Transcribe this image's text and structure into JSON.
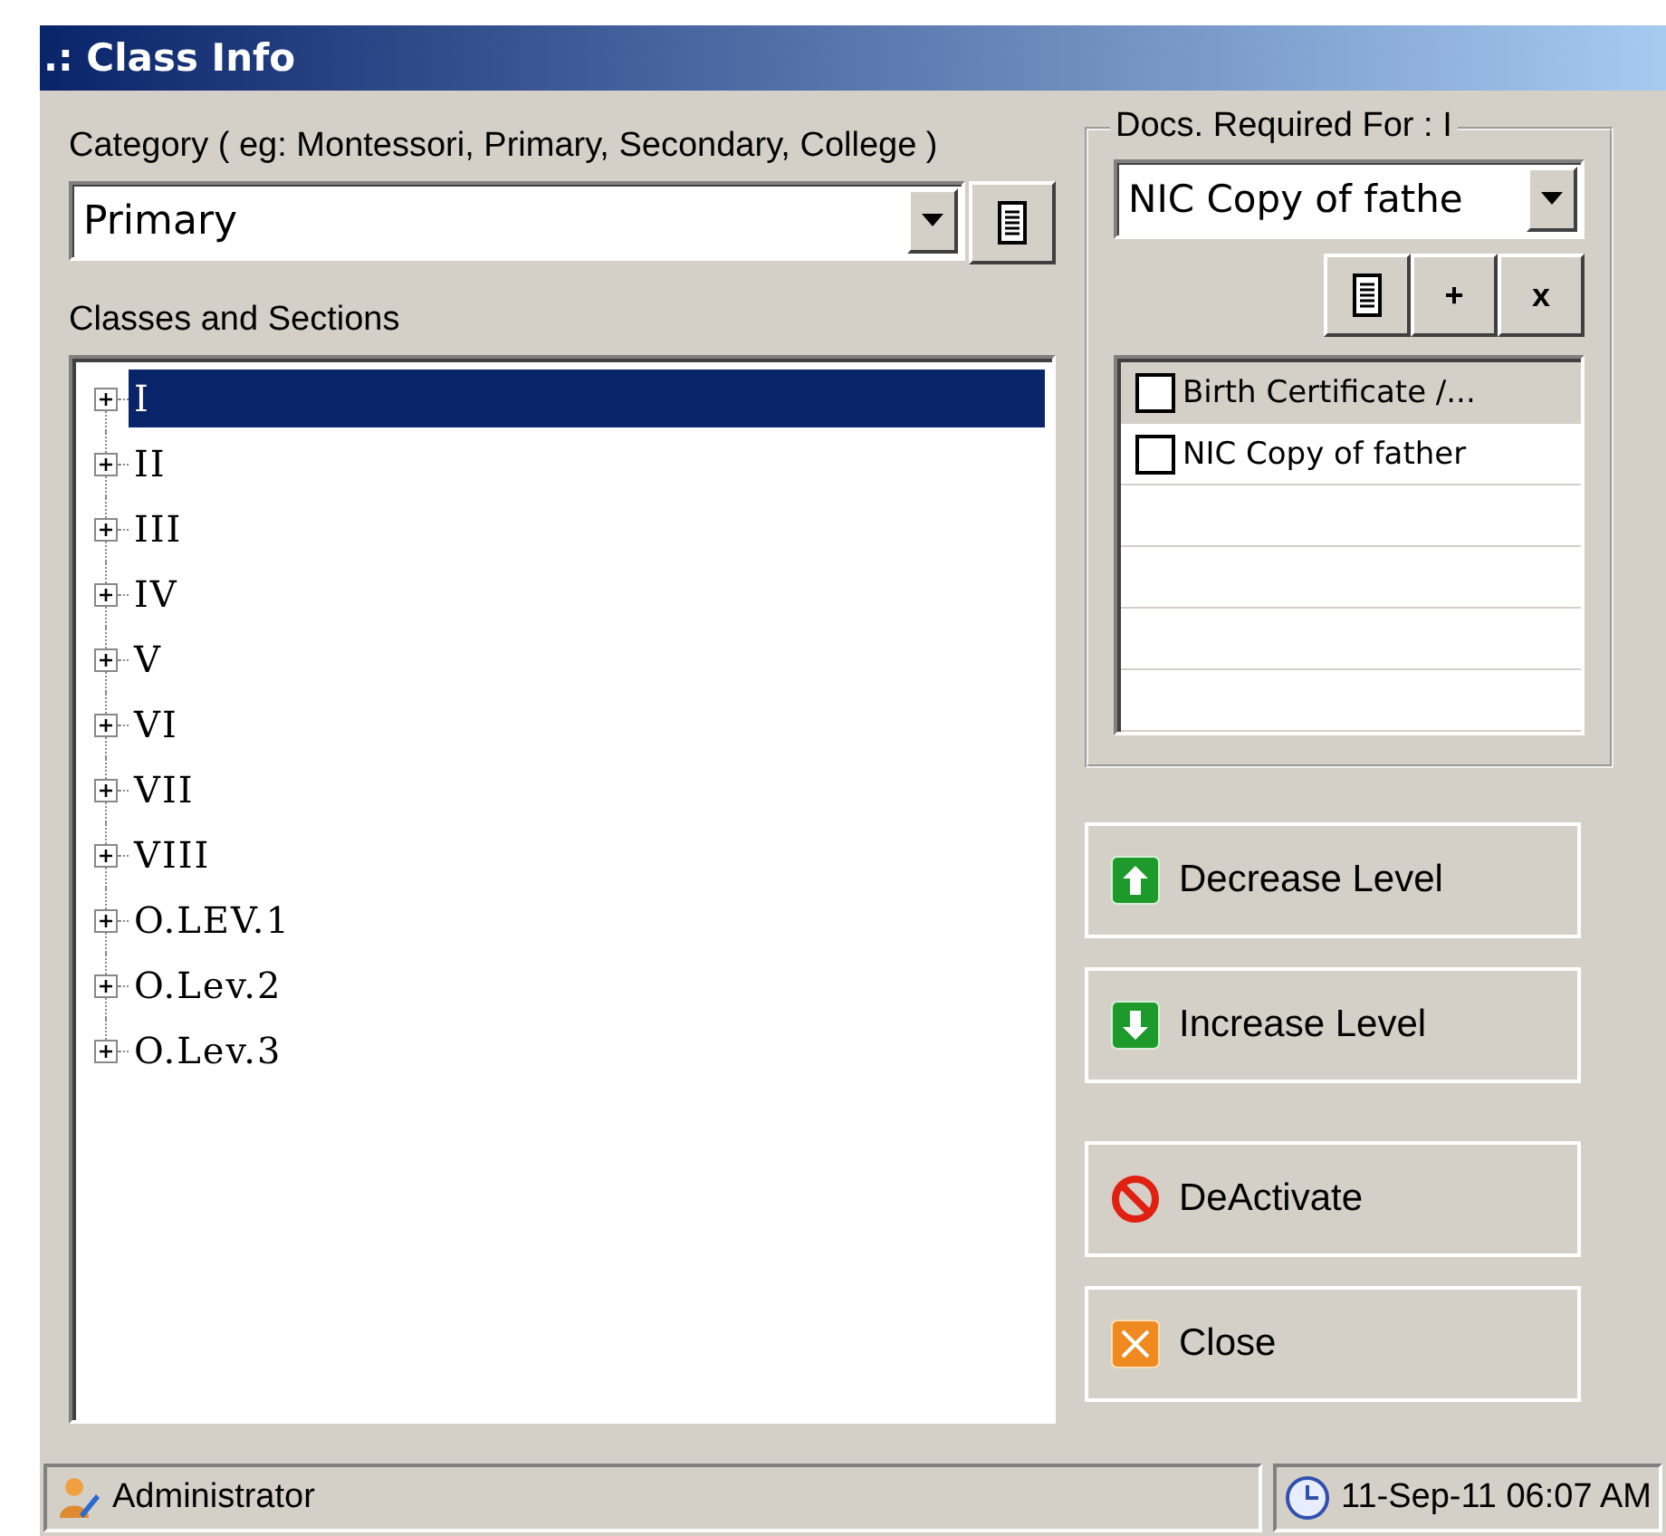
{
  "window": {
    "title": ".: Class Info"
  },
  "category": {
    "label": "Category ( eg: Montessori, Primary, Secondary, College )",
    "value": "Primary"
  },
  "classes": {
    "label": "Classes and Sections",
    "items": [
      {
        "label": "I",
        "selected": true,
        "expanded": false
      },
      {
        "label": "II",
        "selected": false,
        "expanded": false
      },
      {
        "label": "III",
        "selected": false,
        "expanded": false
      },
      {
        "label": "IV",
        "selected": false,
        "expanded": false
      },
      {
        "label": "V",
        "selected": false,
        "expanded": false
      },
      {
        "label": "VI",
        "selected": false,
        "expanded": false
      },
      {
        "label": "VII",
        "selected": false,
        "expanded": false
      },
      {
        "label": "VIII",
        "selected": false,
        "expanded": false
      },
      {
        "label": "O.LEV.1",
        "selected": false,
        "expanded": false
      },
      {
        "label": "O.Lev.2",
        "selected": false,
        "expanded": false
      },
      {
        "label": "O.Lev.3",
        "selected": false,
        "expanded": false
      }
    ]
  },
  "docs": {
    "title": "Docs. Required For : I",
    "value": "NIC Copy of fathe",
    "tool_buttons": [
      "+",
      "x"
    ],
    "items": [
      {
        "label": "Birth Certificate /...",
        "checked": false,
        "selected": true
      },
      {
        "label": "NIC Copy of father",
        "checked": false,
        "selected": false
      }
    ]
  },
  "actions": [
    {
      "label": "Decrease Level",
      "kind": "up"
    },
    {
      "label": "Increase Level",
      "kind": "down"
    },
    {
      "label": "DeActivate",
      "kind": "deactivate"
    },
    {
      "label": "Close",
      "kind": "close"
    }
  ],
  "status_bar": {
    "user": "Administrator",
    "datetime": "11-Sep-11 06:07 AM"
  }
}
